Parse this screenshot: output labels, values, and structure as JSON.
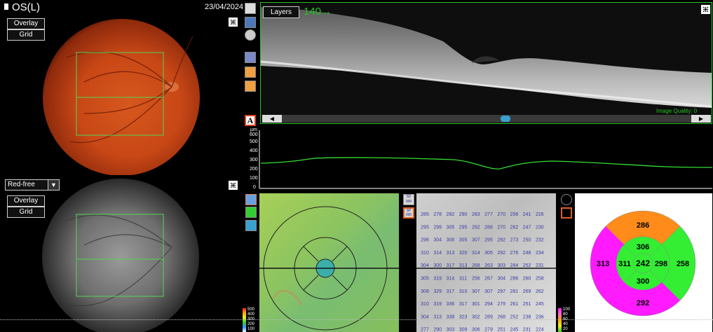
{
  "header": {
    "eye": "OS(L)",
    "date": "23/04/2024"
  },
  "top_fundus": {
    "overlay_label": "Overlay",
    "grid_label": "Grid"
  },
  "bottom_fundus": {
    "mode_select": "Red-free",
    "overlay_label": "Overlay",
    "grid_label": "Grid"
  },
  "bscan": {
    "layers_label": "Layers",
    "slice": "140",
    "slice_arrow": "→",
    "image_quality": "Image Quality: 0"
  },
  "thickness_profile": {
    "unit": "µm",
    "ticks": [
      "600",
      "500",
      "400",
      "300",
      "200",
      "100",
      "0"
    ]
  },
  "map_scale_top": [
    "500",
    "400",
    "300",
    "200",
    "100"
  ],
  "map_scale_bottom": [
    "100",
    "80",
    "60",
    "40",
    "20"
  ],
  "map_buttons": {
    "sd_label": "SD",
    "sd_value": "000",
    "sp_label": "SP",
    "sp_value": "000"
  },
  "thickness_grid": [
    [
      "285",
      "278",
      "282",
      "290",
      "283",
      "277",
      "270",
      "256",
      "241",
      "226"
    ],
    [
      "295",
      "299",
      "305",
      "295",
      "292",
      "286",
      "270",
      "262",
      "247",
      "230"
    ],
    [
      "296",
      "304",
      "308",
      "305",
      "307",
      "295",
      "282",
      "273",
      "250",
      "232"
    ],
    [
      "310",
      "314",
      "313",
      "320",
      "314",
      "305",
      "292",
      "276",
      "248",
      "234"
    ],
    [
      "304",
      "300",
      "317",
      "313",
      "268",
      "263",
      "303",
      "284",
      "252",
      "231"
    ],
    [
      "305",
      "319",
      "314",
      "311",
      "256",
      "267",
      "304",
      "286",
      "260",
      "258"
    ],
    [
      "308",
      "329",
      "317",
      "310",
      "307",
      "307",
      "297",
      "281",
      "269",
      "262"
    ],
    [
      "310",
      "319",
      "336",
      "317",
      "301",
      "294",
      "279",
      "261",
      "251",
      "245"
    ],
    [
      "304",
      "313",
      "338",
      "323",
      "302",
      "289",
      "268",
      "252",
      "238",
      "236"
    ],
    [
      "277",
      "290",
      "303",
      "309",
      "306",
      "279",
      "251",
      "245",
      "231",
      "224"
    ]
  ],
  "etdrs": {
    "center": "242",
    "inner_superior": "306",
    "inner_nasal": "298",
    "inner_inferior": "300",
    "inner_temporal": "311",
    "outer_superior": "286",
    "outer_nasal": "258",
    "outer_inferior": "292",
    "outer_temporal": "313"
  },
  "colors": {
    "accent_green": "#21c421",
    "outer_orange": "#ff8c1a",
    "magenta": "#ff1aff",
    "green_sector": "#33ee33"
  }
}
